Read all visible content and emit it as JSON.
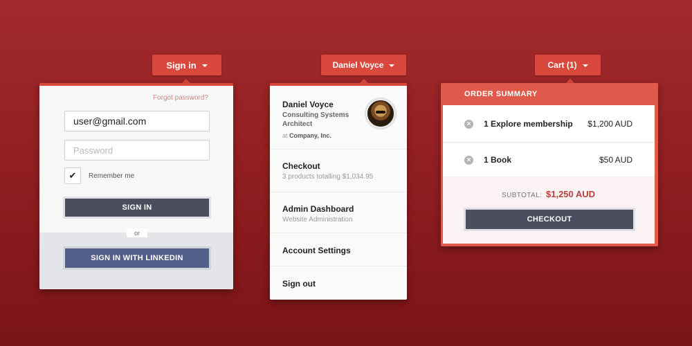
{
  "signin": {
    "trigger_label": "Sign in",
    "forgot_password": "Forgot password?",
    "email_value": "user@gmail.com",
    "password_placeholder": "Password",
    "remember_label": "Remember me",
    "remember_checked": true,
    "checkmark": "✔",
    "signin_button": "SIGN IN",
    "or_label": "or",
    "linkedin_button": "SIGN IN WITH LINKEDIN"
  },
  "user_menu": {
    "trigger_label": "Daniel Voyce",
    "name": "Daniel Voyce",
    "role": "Consulting Systems Architect",
    "company_prefix": "at ",
    "company": "Company, Inc.",
    "items": [
      {
        "title": "Checkout",
        "subtitle": "3 products totalling $1,034.95"
      },
      {
        "title": "Admin Dashboard",
        "subtitle": "Website Administration"
      },
      {
        "title": "Account Settings"
      },
      {
        "title": "Sign out"
      }
    ]
  },
  "cart": {
    "trigger_label": "Cart (1)",
    "header": "ORDER SUMMARY",
    "remove_glyph": "×",
    "items": [
      {
        "name": "1 Explore membership",
        "price": "$1,200 AUD"
      },
      {
        "name": "1 Book",
        "price": "$50 AUD"
      }
    ],
    "subtotal_label": "SUBTOTAL:",
    "subtotal_value": "$1,250 AUD",
    "checkout_button": "CHECKOUT"
  },
  "colors": {
    "accent": "#d9483d",
    "button_dark": "#4a4e5f",
    "linkedin": "#525f88",
    "subtotal": "#b8403a"
  }
}
